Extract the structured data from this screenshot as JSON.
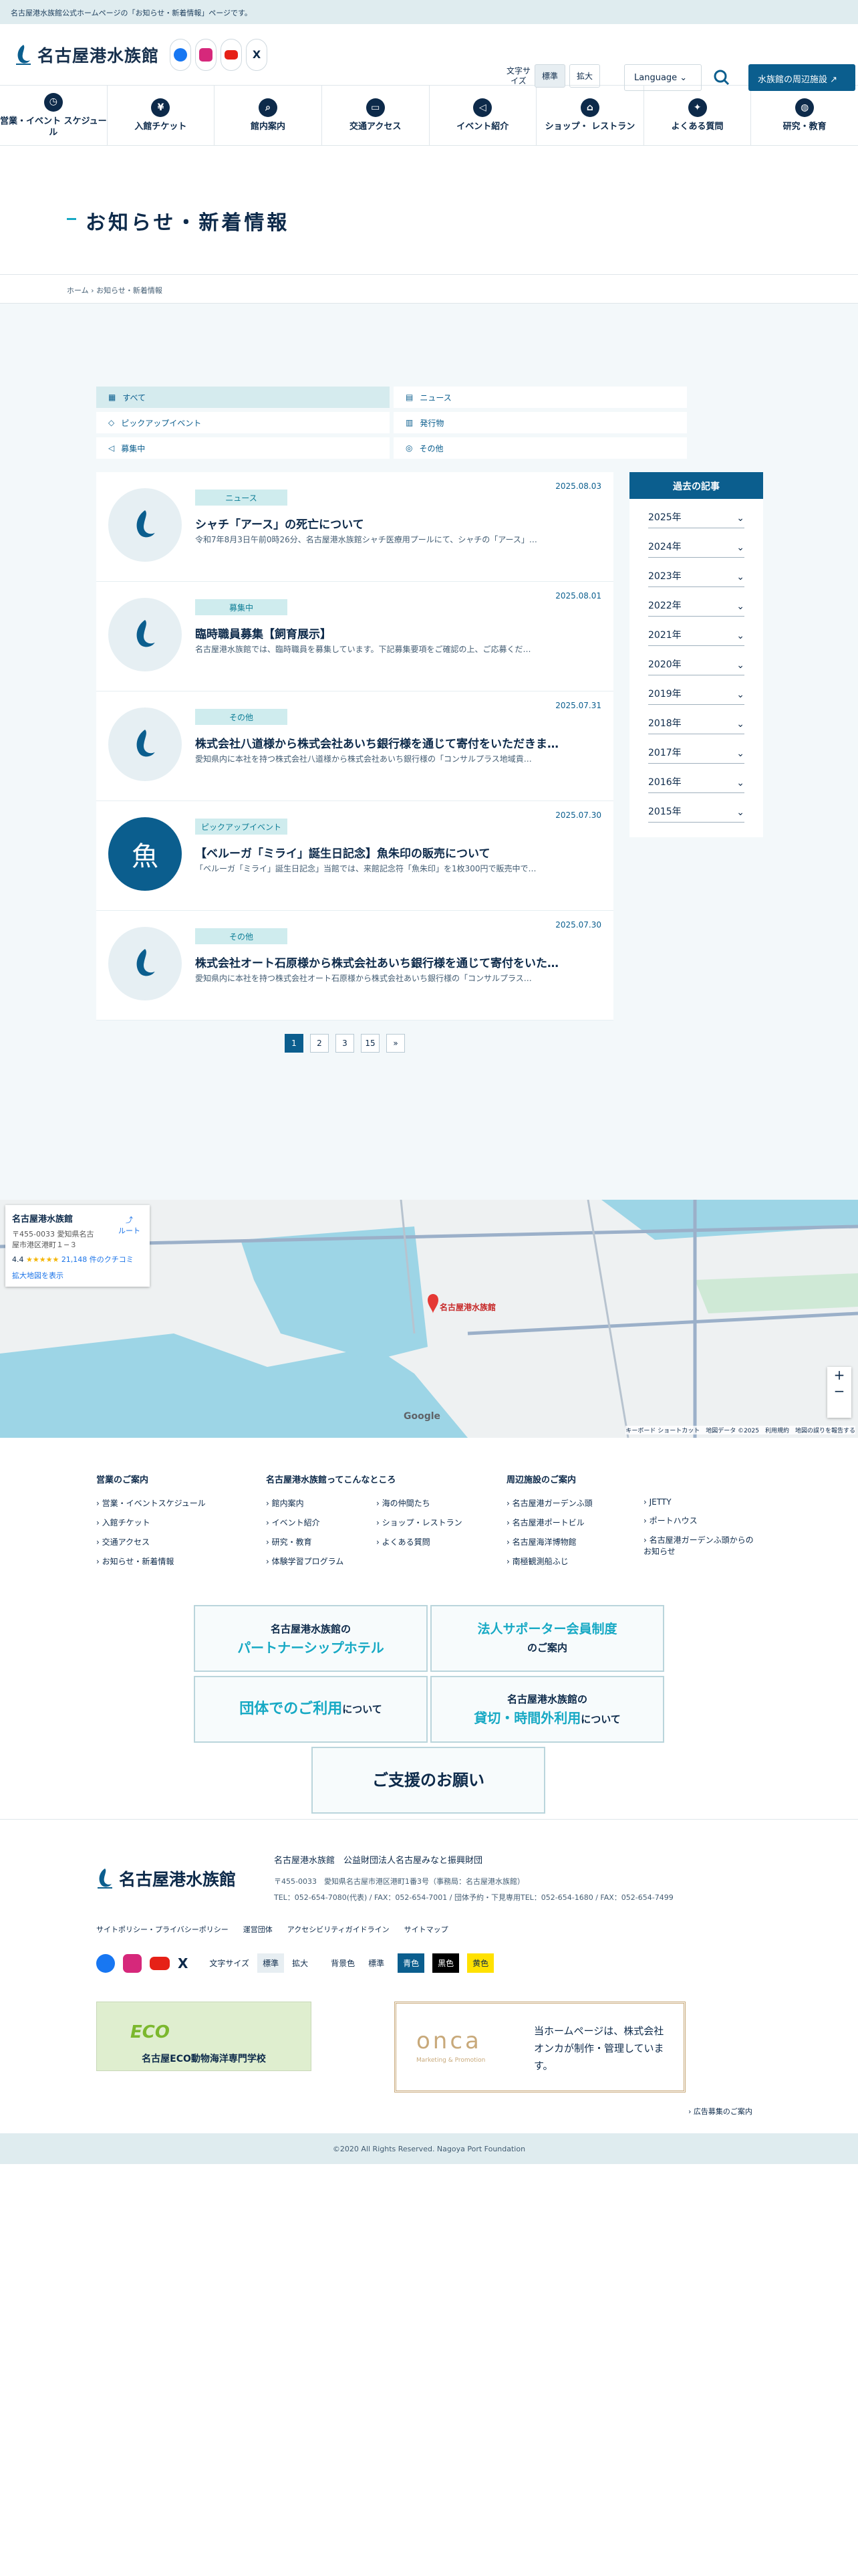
{
  "notice": "名古屋港水族館公式ホームページの「お知らせ・新着情報」ページです。",
  "header": {
    "logo": "名古屋港水族館",
    "font_size_label": "文字サイズ",
    "font_std": "標準",
    "font_big": "拡大",
    "language": "Language",
    "nearby": "水族館の周辺施設"
  },
  "gnav": [
    {
      "label": "営業・イベント スケジュール",
      "icon": "clock-icon"
    },
    {
      "label": "入館チケット",
      "icon": "yen-icon"
    },
    {
      "label": "館内案内",
      "icon": "map-search-icon"
    },
    {
      "label": "交通アクセス",
      "icon": "bus-icon"
    },
    {
      "label": "イベント紹介",
      "icon": "megaphone-icon"
    },
    {
      "label": "ショップ・ レストラン",
      "icon": "shop-icon"
    },
    {
      "label": "よくある質問",
      "icon": "lightbulb-icon"
    },
    {
      "label": "研究・教育",
      "icon": "globe-icon"
    }
  ],
  "page_title": "お知らせ・新着情報",
  "breadcrumb": {
    "home": "ホーム",
    "current": "お知らせ・新着情報"
  },
  "filters": [
    {
      "label": "すべて",
      "icon": "grid-icon",
      "on": true
    },
    {
      "label": "ニュース",
      "icon": "document-icon",
      "on": false
    },
    {
      "label": "ピックアップイベント",
      "icon": "ticket-icon",
      "on": false
    },
    {
      "label": "発行物",
      "icon": "book-icon",
      "on": false
    },
    {
      "label": "募集中",
      "icon": "megaphone-icon",
      "on": false
    },
    {
      "label": "その他",
      "icon": "other-icon",
      "on": false
    }
  ],
  "news": [
    {
      "cat": "ニュース",
      "date": "2025.08.03",
      "title": "シャチ「アース」の死亡について",
      "excerpt": "令和7年8月3日午前0時26分、名古屋港水族館シャチ医療用プールにて、シャチの「アース」…"
    },
    {
      "cat": "募集中",
      "date": "2025.08.01",
      "title": "臨時職員募集【飼育展示】",
      "excerpt": "名古屋港水族館では、臨時職員を募集しています。下記募集要項をご確認の上、ご応募くだ…"
    },
    {
      "cat": "その他",
      "date": "2025.07.31",
      "title": "株式会社八道様から株式会社あいち銀行様を通じて寄付をいただきま…",
      "excerpt": "愛知県内に本社を持つ株式会社八道様から株式会社あいち銀行様の「コンサルプラス地域貢…"
    },
    {
      "cat": "ピックアップイベント",
      "date": "2025.07.30",
      "title": "【ベルーガ「ミライ」誕生日記念】魚朱印の販売について",
      "excerpt": "「ベルーガ「ミライ」誕生日記念」当館では、来館記念符「魚朱印」を1枚300円で販売中で…"
    },
    {
      "cat": "その他",
      "date": "2025.07.30",
      "title": "株式会社オート石原様から株式会社あいち銀行様を通じて寄付をいた…",
      "excerpt": "愛知県内に本社を持つ株式会社オート石原様から株式会社あいち銀行様の「コンサルプラス…"
    }
  ],
  "archive": {
    "title": "過去の記事",
    "years": [
      "2025年",
      "2024年",
      "2023年",
      "2022年",
      "2021年",
      "2020年",
      "2019年",
      "2018年",
      "2017年",
      "2016年",
      "2015年"
    ]
  },
  "pager": [
    "1",
    "2",
    "3",
    "15",
    "»"
  ],
  "map": {
    "name": "名古屋港水族館",
    "address": "〒455-0033 愛知県名古屋市港区港町１−３",
    "route": "ルート",
    "rating": "4.4",
    "reviews": "21,148 件のクチコミ",
    "enlarge": "拡大地図を表示",
    "pin": "名古屋港水族館",
    "google": "Google",
    "attrib": "キーボード ショートカット　地図データ ©2025　利用規約　地図の誤りを報告する"
  },
  "footer_nav": {
    "c1": {
      "title": "営業のご案内",
      "items": [
        "営業・イベントスケジュール",
        "入館チケット",
        "交通アクセス",
        "お知らせ・新着情報"
      ]
    },
    "c2": {
      "title": "名古屋港水族館ってこんなところ",
      "items": [
        "館内案内",
        "イベント紹介",
        "研究・教育",
        "体験学習プログラム",
        "海の仲間たち",
        "ショップ・レストラン",
        "よくある質問"
      ]
    },
    "c3": {
      "title": "周辺施設のご案内",
      "items": [
        "名古屋港ガーデンふ頭",
        "名古屋港ポートビル",
        "名古屋海洋博物館",
        "南極観測船ふじ",
        "JETTY",
        "ポートハウス",
        "名古屋港ガーデンふ頭からのお知らせ"
      ]
    }
  },
  "banners": {
    "b1a": "名古屋港水族館の",
    "b1b": "パートナーシップホテル",
    "b2a": "法人サポーター会員制度",
    "b2b": "のご案内",
    "b3a": "団体でのご利用",
    "b3b": "について",
    "b4a": "名古屋港水族館の",
    "b4b": "貸切・時間外利用",
    "b4c": "について",
    "b5": "ご支援のお願い"
  },
  "footer": {
    "logo": "名古屋港水族館",
    "org": "名古屋港水族館　公益財団法人名古屋みなと振興財団",
    "addr": "〒455-0033　愛知県名古屋市港区港町1番3号（事務局：名古屋港水族館）",
    "tel": "TEL：052-654-7080(代表) / FAX：052-654-7001 / 団体予約・下見専用TEL：052-654-1680 / FAX：052-654-7499",
    "links": [
      "サイトポリシー・プライバシーポリシー",
      "運営団体",
      "アクセシビリティガイドライン",
      "サイトマップ"
    ],
    "fs": "文字サイズ",
    "std": "標準",
    "big": "拡大",
    "bg": "背景色",
    "bg_std": "標準",
    "bg_blue": "青色",
    "bg_black": "黒色",
    "bg_yellow": "黄色",
    "eco": "名古屋ECO動物海洋専門学校",
    "onca_logo": "onca",
    "onca_sub": "Marketing & Promotion",
    "onca_text": "当ホームページは、株式会社オンカが制作・管理しています。",
    "ad": "広告募集のご案内"
  },
  "copyright": "©2020 All Rights Reserved. Nagoya Port Foundation",
  "colors": {
    "primary": "#0b5e8e",
    "accent": "#17a9c4",
    "navy": "#0d2a4a"
  }
}
